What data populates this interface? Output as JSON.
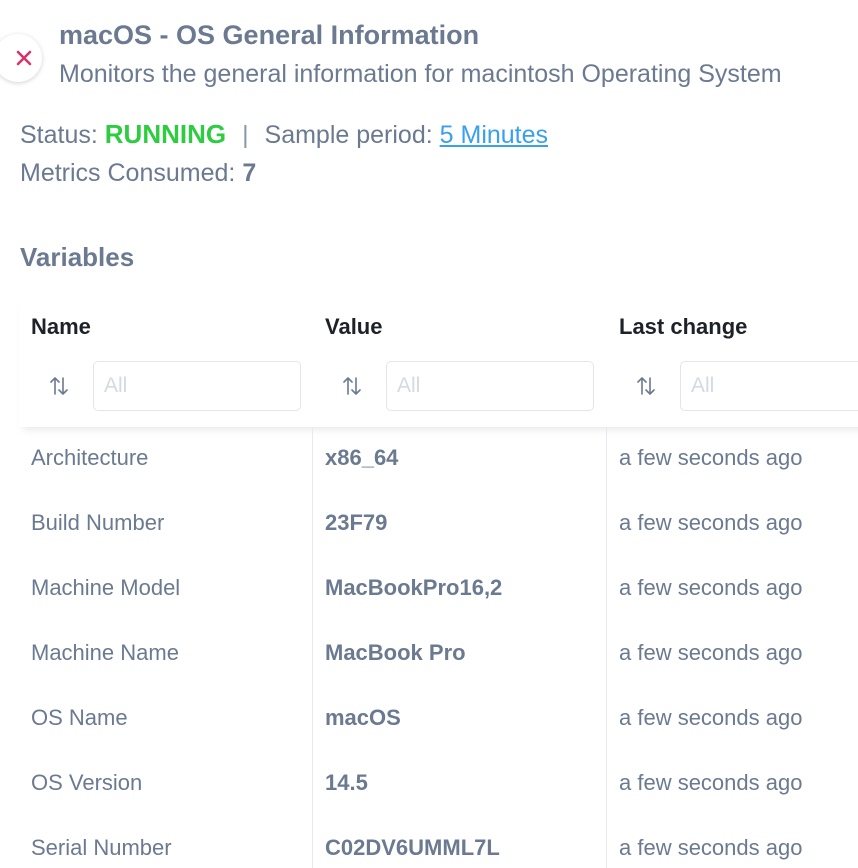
{
  "header": {
    "title": "macOS - OS General Information",
    "subtitle": "Monitors the general information for macintosh Operating System"
  },
  "status": {
    "label": "Status:",
    "value": "RUNNING",
    "separator": "|",
    "sample_label": "Sample period:",
    "sample_value": "5 Minutes"
  },
  "metrics": {
    "label": "Metrics Consumed:",
    "value": "7"
  },
  "variables": {
    "title": "Variables",
    "columns": [
      "Name",
      "Value",
      "Last change"
    ],
    "filter_placeholder": "All",
    "rows": [
      {
        "name": "Architecture",
        "value": "x86_64",
        "last_change": "a few seconds ago"
      },
      {
        "name": "Build Number",
        "value": "23F79",
        "last_change": "a few seconds ago"
      },
      {
        "name": "Machine Model",
        "value": "MacBookPro16,2",
        "last_change": "a few seconds ago"
      },
      {
        "name": "Machine Name",
        "value": "MacBook Pro",
        "last_change": "a few seconds ago"
      },
      {
        "name": "OS Name",
        "value": "macOS",
        "last_change": "a few seconds ago"
      },
      {
        "name": "OS Version",
        "value": "14.5",
        "last_change": "a few seconds ago"
      },
      {
        "name": "Serial Number",
        "value": "C02DV6UMML7L",
        "last_change": "a few seconds ago"
      }
    ]
  },
  "icons": {
    "close": "close-icon",
    "sort": "sort-arrows-icon"
  },
  "colors": {
    "running": "#2ecc40",
    "link": "#3aa0ea",
    "close_icon": "#d6336c",
    "text": "#6b7a90",
    "header_text": "#1e2228"
  }
}
